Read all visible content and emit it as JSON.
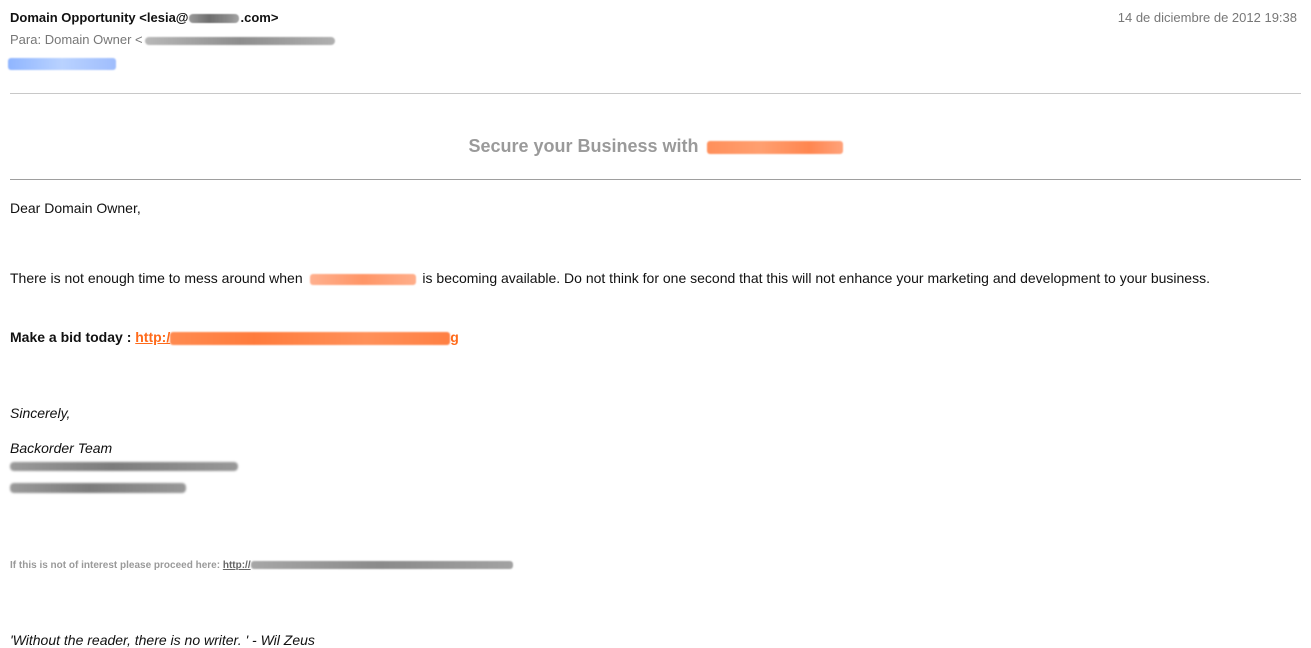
{
  "header": {
    "from_name": "Domain Opportunity",
    "from_email_prefix": "<lesia@",
    "from_email_suffix": ".com>",
    "date": "14 de diciembre de 2012 19:38",
    "to_label": "Para:",
    "to_value": "Domain Owner <"
  },
  "banner": {
    "text": "Secure your Business with"
  },
  "body": {
    "greeting": "Dear Domain Owner,",
    "paragraph_before": "There is not enough time to mess around when",
    "paragraph_after": "is becoming available. Do not think for one second that this will not enhance your marketing and development to your business.",
    "bid_label": "Make a bid today :",
    "bid_link_prefix": "http:/",
    "bid_link_suffix": "g",
    "sign_off": "Sincerely,",
    "team": "Backorder Team"
  },
  "footer": {
    "unsubscribe_text": "If this is not of interest please proceed here:",
    "unsubscribe_link_prefix": "http://",
    "quote": "'Without the reader, there is no writer. ' - Wil Zeus"
  },
  "colors": {
    "link_orange": "#ff6a1a",
    "muted_gray": "#777777",
    "banner_gray": "#9a9a9a"
  }
}
